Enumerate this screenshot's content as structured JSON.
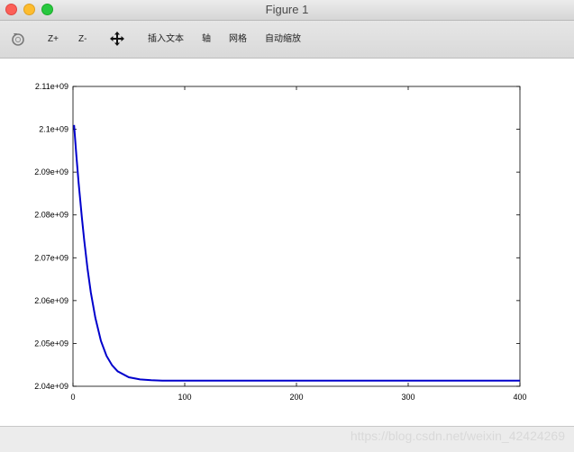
{
  "window": {
    "title": "Figure 1"
  },
  "toolbar": {
    "rotate_icon": "rotate-icon",
    "zoom_in_label": "Z+",
    "zoom_out_label": "Z-",
    "pan_icon": "pan-arrows-icon",
    "insert_text_label": "插入文本",
    "axis_label": "轴",
    "grid_label": "网格",
    "autoscale_label": "自动缩放"
  },
  "watermark": "https://blog.csdn.net/weixin_42424269",
  "chart_data": {
    "type": "line",
    "title": "",
    "xlabel": "",
    "ylabel": "",
    "xlim": [
      0,
      400
    ],
    "ylim": [
      2040000000,
      2110000000
    ],
    "x_ticks": [
      0,
      100,
      200,
      300,
      400
    ],
    "x_tick_labels": [
      "0",
      "100",
      "200",
      "300",
      "400"
    ],
    "y_ticks": [
      2040000000,
      2050000000,
      2060000000,
      2070000000,
      2080000000,
      2090000000,
      2100000000,
      2110000000
    ],
    "y_tick_labels": [
      "2.04e+09",
      "2.05e+09",
      "2.06e+09",
      "2.07e+09",
      "2.08e+09",
      "2.09e+09",
      "2.1e+09",
      "2.11e+09"
    ],
    "grid": false,
    "line_color": "#0000cc",
    "series": [
      {
        "x": [
          1,
          3,
          5,
          8,
          10,
          13,
          16,
          20,
          25,
          30,
          35,
          40,
          50,
          60,
          70,
          80,
          100,
          150,
          200,
          250,
          300,
          350,
          400
        ],
        "values": [
          2101000000,
          2094000000,
          2087600000,
          2079300000,
          2074200000,
          2067500000,
          2061900000,
          2056000000,
          2050600000,
          2047100000,
          2044900000,
          2043500000,
          2042100000,
          2041600000,
          2041400000,
          2041300000,
          2041300000,
          2041300000,
          2041300000,
          2041300000,
          2041300000,
          2041300000,
          2041300000
        ]
      }
    ]
  }
}
